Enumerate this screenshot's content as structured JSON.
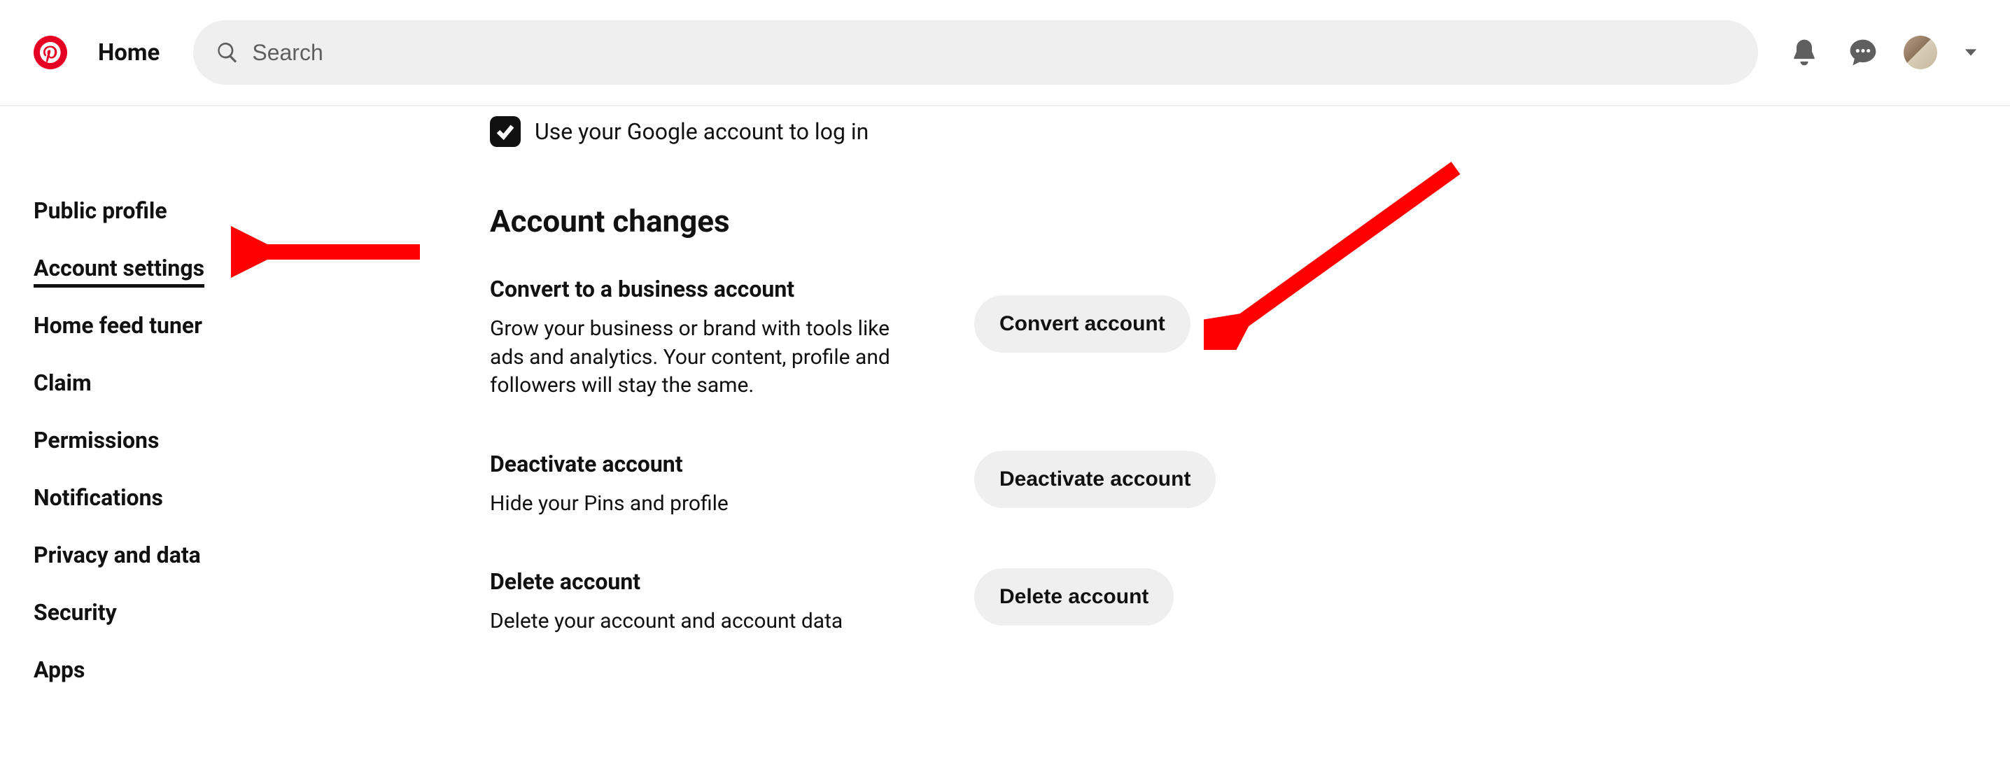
{
  "header": {
    "home_label": "Home",
    "search_placeholder": "Search"
  },
  "sidebar": {
    "items": [
      {
        "label": "Public profile"
      },
      {
        "label": "Account settings"
      },
      {
        "label": "Home feed tuner"
      },
      {
        "label": "Claim"
      },
      {
        "label": "Permissions"
      },
      {
        "label": "Notifications"
      },
      {
        "label": "Privacy and data"
      },
      {
        "label": "Security"
      },
      {
        "label": "Apps"
      }
    ],
    "active_index": 1
  },
  "content": {
    "google_login_label": "Use your Google account to log in",
    "google_login_checked": true,
    "section_heading": "Account changes",
    "rows": [
      {
        "title": "Convert to a business account",
        "desc": "Grow your business or brand with tools like ads and analytics. Your content, profile and followers will stay the same.",
        "button": "Convert account"
      },
      {
        "title": "Deactivate account",
        "desc": "Hide your Pins and profile",
        "button": "Deactivate account"
      },
      {
        "title": "Delete account",
        "desc": "Delete your account and account data",
        "button": "Delete account"
      }
    ]
  },
  "annotations": {
    "arrow_color": "#ff0000"
  }
}
